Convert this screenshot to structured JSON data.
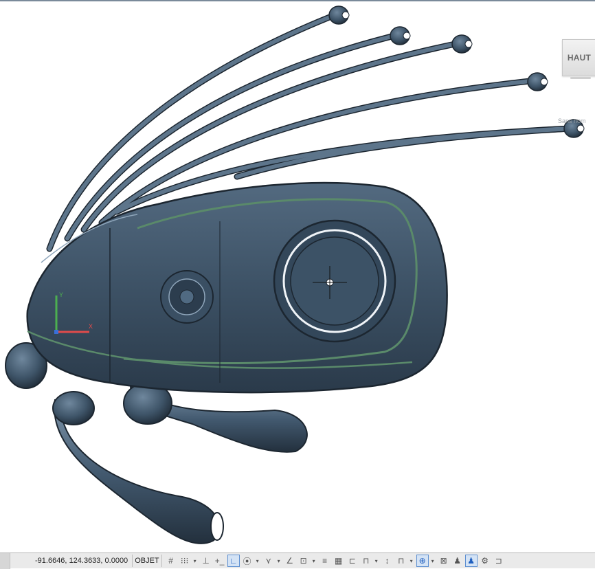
{
  "viewport": {
    "view_cube_label": "HAUT",
    "wcs_label": "Sans nom",
    "ucs_axes": {
      "x_color": "#e04b4b",
      "y_color": "#4caf50",
      "z_color": "#3a6fd8"
    },
    "model_colors": {
      "body": "#3d5266",
      "edge": "#1c2630",
      "highlight": "#8fa6bb",
      "green_stripe": "#5a8a6a"
    }
  },
  "statusbar": {
    "coordinates": "-91.6646, 124.3633, 0.0000",
    "objet_label": "OBJET",
    "tools": [
      {
        "name": "grid-icon",
        "glyph": "#",
        "active": false,
        "caret": false
      },
      {
        "name": "snap-icon",
        "glyph": "⁝⁝⁝",
        "active": false,
        "caret": true
      },
      {
        "name": "infer-icon",
        "glyph": "⊥",
        "active": false,
        "caret": false
      },
      {
        "name": "dynamic-input-icon",
        "glyph": "+_",
        "active": false,
        "caret": false
      },
      {
        "name": "ortho-icon",
        "glyph": "∟",
        "active": true,
        "caret": false
      },
      {
        "name": "polar-icon",
        "glyph": "⦿",
        "active": false,
        "caret": true
      },
      {
        "name": "isodraft-icon",
        "glyph": "⋎",
        "active": false,
        "caret": true
      },
      {
        "name": "object-snap-tracking-icon",
        "glyph": "∠",
        "active": false,
        "caret": false
      },
      {
        "name": "object-snap-icon",
        "glyph": "⊡",
        "active": false,
        "caret": true
      },
      {
        "name": "lineweight-icon",
        "glyph": "≡",
        "active": false,
        "caret": false
      },
      {
        "name": "transparency-icon",
        "glyph": "▦",
        "active": false,
        "caret": false
      },
      {
        "name": "selection-cycling-icon",
        "glyph": "⊏",
        "active": false,
        "caret": false
      },
      {
        "name": "3d-osnap-icon",
        "glyph": "⊓",
        "active": false,
        "caret": true
      },
      {
        "name": "dynamic-ucs-icon",
        "glyph": "↕",
        "active": false,
        "caret": false
      },
      {
        "name": "selection-filter-icon",
        "glyph": "⊓",
        "active": false,
        "caret": true
      },
      {
        "name": "gizmo-icon",
        "glyph": "⊕",
        "active": true,
        "caret": true
      },
      {
        "name": "annotation-visibility-icon",
        "glyph": "⊠",
        "active": false,
        "caret": false
      },
      {
        "name": "annotation-scale-icon",
        "glyph": "♟",
        "active": false,
        "caret": false
      },
      {
        "name": "auto-scale-icon",
        "glyph": "♟",
        "active": true,
        "caret": false
      },
      {
        "name": "workspace-icon",
        "glyph": "⚙",
        "active": false,
        "caret": false
      },
      {
        "name": "lock-ui-icon",
        "glyph": "⊐",
        "active": false,
        "caret": false
      }
    ]
  }
}
